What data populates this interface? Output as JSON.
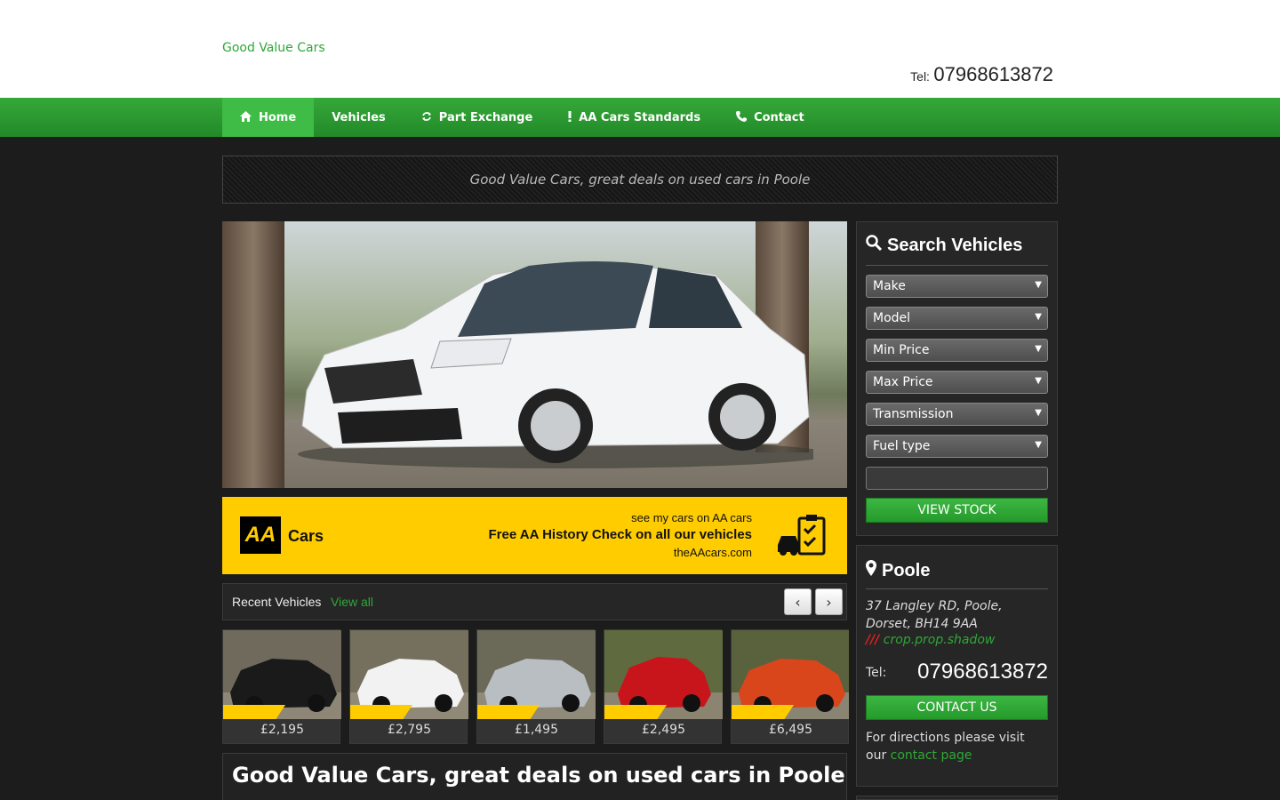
{
  "header": {
    "site_title": "Good Value Cars",
    "tel_label": "Tel:",
    "tel_number": "07968613872"
  },
  "nav": {
    "items": [
      {
        "label": "Home",
        "icon": "home-icon",
        "active": true
      },
      {
        "label": "Vehicles",
        "icon": "",
        "active": false
      },
      {
        "label": "Part Exchange",
        "icon": "refresh-icon",
        "active": false
      },
      {
        "label": "AA Cars Standards",
        "icon": "exclamation-icon",
        "active": false
      },
      {
        "label": "Contact",
        "icon": "phone-icon",
        "active": false
      }
    ]
  },
  "tagline": "Good Value Cars, great deals on used cars in Poole",
  "aa_banner": {
    "logo": "AA",
    "brand": "Cars",
    "line1": "see my cars on AA cars",
    "line2": "Free AA History Check on all our vehicles",
    "line3": "theAAcars.com"
  },
  "recent": {
    "title": "Recent Vehicles",
    "view_all": "View all",
    "prev": "‹",
    "next": "›",
    "vehicles": [
      {
        "price": "£2,195",
        "color": "#1a1a1a"
      },
      {
        "price": "£2,795",
        "color": "#f2f2f2"
      },
      {
        "price": "£1,495",
        "color": "#b9bec3"
      },
      {
        "price": "£2,495",
        "color": "#c8151b"
      },
      {
        "price": "£6,495",
        "color": "#d9461c"
      }
    ]
  },
  "intro": {
    "title": "Good Value Cars, great deals on used cars in Poole"
  },
  "search": {
    "title": "Search Vehicles",
    "fields": [
      "Make",
      "Model",
      "Min Price",
      "Max Price",
      "Transmission",
      "Fuel type"
    ],
    "button": "VIEW STOCK"
  },
  "location": {
    "title": "Poole",
    "address": "37 Langley RD, Poole, Dorset, BH14 9AA",
    "crop_slashes": "///",
    "crop_text": "crop.prop.shadow",
    "tel_label": "Tel:",
    "tel_number": "07968613872",
    "button": "CONTACT US",
    "directions_text": "For directions please visit our",
    "directions_link": "contact page"
  },
  "colors": {
    "brand_green": "#2ea836",
    "aa_yellow": "#ffcc00",
    "background": "#1c1c1c"
  }
}
